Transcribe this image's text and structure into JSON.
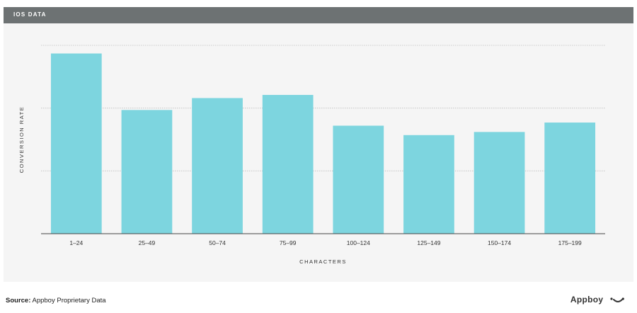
{
  "header": {
    "title": "IOS DATA"
  },
  "footer": {
    "source_label": "Source:",
    "source_text": "Appboy Proprietary Data"
  },
  "brand": {
    "name": "Appboy",
    "icon": "smile-icon"
  },
  "colors": {
    "bar": "#7dd5df",
    "header_bg": "#6d7273",
    "panel_bg": "#f5f5f5",
    "axis": "#444444",
    "grid": "#bdbdbd"
  },
  "chart_data": {
    "type": "bar",
    "title": "",
    "xlabel": "CHARACTERS",
    "ylabel": "CONVERSION RATE",
    "categories": [
      "1–24",
      "25–49",
      "50–74",
      "75–99",
      "100–124",
      "125–149",
      "150–174",
      "175–199"
    ],
    "values": [
      2.87,
      1.97,
      2.16,
      2.21,
      1.72,
      1.57,
      1.62,
      1.77
    ],
    "ylim": [
      0,
      3
    ],
    "y_ticks_labeled": false,
    "grid": true
  }
}
